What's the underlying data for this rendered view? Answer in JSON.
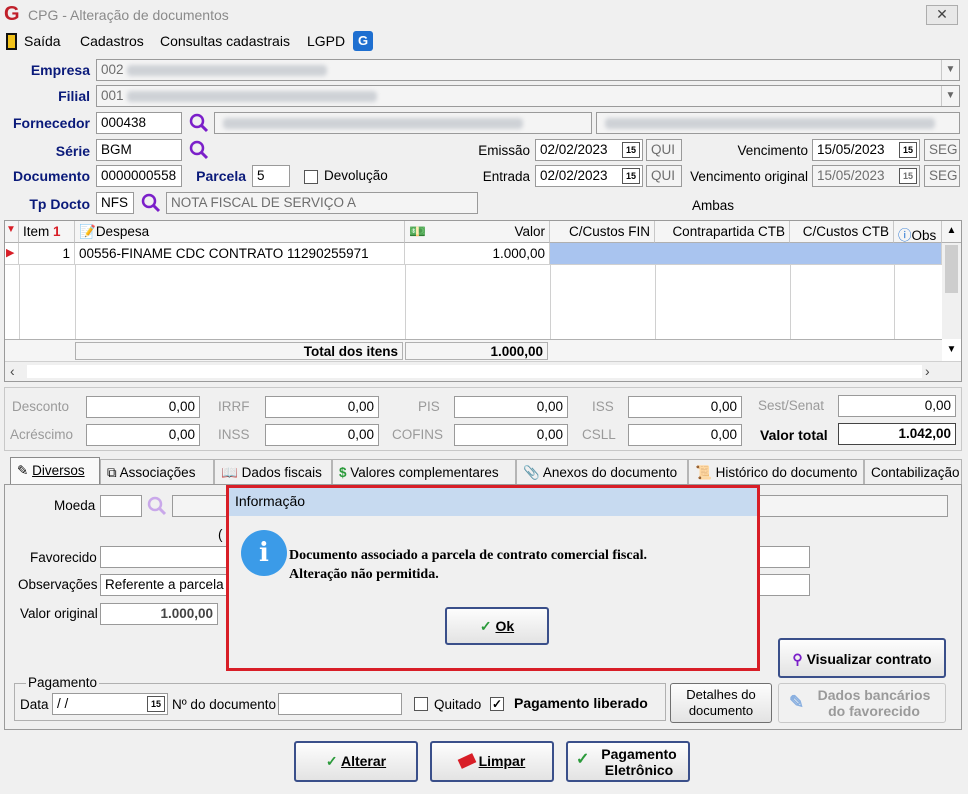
{
  "window": {
    "title": "CPG - Alteração de documentos",
    "close_label": "✕",
    "logo": "G"
  },
  "menu": {
    "items": [
      "Saída",
      "Cadastros",
      "Consultas cadastrais",
      "LGPD"
    ]
  },
  "header": {
    "empresa_label": "Empresa",
    "empresa_code": "002",
    "filial_label": "Filial",
    "filial_code": "001",
    "fornecedor_label": "Fornecedor",
    "fornecedor_code": "000438",
    "serie_label": "Série",
    "serie_value": "BGM",
    "documento_label": "Documento",
    "documento_value": "0000000558",
    "parcela_label": "Parcela",
    "parcela_value": "5",
    "devolucao_label": "Devolução",
    "tpdocto_label": "Tp Docto",
    "tpdocto_value": "NFS",
    "tpdocto_desc": "NOTA FISCAL DE SERVIÇO A",
    "emissao_label": "Emissão",
    "emissao_value": "02/02/2023",
    "emissao_day": "QUI",
    "entrada_label": "Entrada",
    "entrada_value": "02/02/2023",
    "entrada_day": "QUI",
    "vencimento_label": "Vencimento",
    "vencimento_value": "15/05/2023",
    "vencimento_day": "SEG",
    "venc_original_label": "Vencimento original",
    "venc_original_value": "15/05/2023",
    "venc_original_day": "SEG",
    "ambas_label": "Ambas"
  },
  "grid": {
    "columns": [
      "Item",
      "Despesa",
      "Valor",
      "C/Custos FIN",
      "Contrapartida CTB",
      "C/Custos CTB",
      "Obs"
    ],
    "rows": [
      {
        "item": "1",
        "despesa": "00556-FINAME CDC CONTRATO 11290255971",
        "valor": "1.000,00"
      }
    ],
    "total_label": "Total dos itens",
    "total_value": "1.000,00"
  },
  "totals": {
    "desconto_label": "Desconto",
    "desconto": "0,00",
    "acrescimo_label": "Acréscimo",
    "acrescimo": "0,00",
    "irrf_label": "IRRF",
    "irrf": "0,00",
    "inss_label": "INSS",
    "inss": "0,00",
    "pis_label": "PIS",
    "pis": "0,00",
    "cofins_label": "COFINS",
    "cofins": "0,00",
    "iss_label": "ISS",
    "iss": "0,00",
    "csll_label": "CSLL",
    "csll": "0,00",
    "sest_label": "Sest/Senat",
    "sest": "0,00",
    "valor_total_label": "Valor total",
    "valor_total": "1.042,00"
  },
  "tabs": [
    "Diversos",
    "Associações",
    "Dados fiscais",
    "Valores complementares",
    "Anexos do documento",
    "Histórico do documento",
    "Contabilização"
  ],
  "diversos": {
    "moeda_label": "Moeda",
    "favorecido_label": "Favorecido",
    "observacoes_label": "Observações",
    "observacoes_value": "Referente a parcela n",
    "valor_original_label": "Valor original",
    "valor_original_value": "1.000,00",
    "pagamento_group": "Pagamento",
    "data_label": "Data",
    "data_value": " /  /",
    "ndoc_label": "Nº do documento",
    "quitado_label": "Quitado",
    "pagamento_liberado_label": "Pagamento liberado",
    "detalhes_label_1": "Detalhes do",
    "detalhes_label_2": "documento",
    "visualizar_label": "Visualizar contrato",
    "dados_bancarios_1": "Dados bancários",
    "dados_bancarios_2": "do favorecido",
    "paren": "("
  },
  "dialog": {
    "title": "Informação",
    "line1": "Documento associado a parcela de contrato comercial fiscal.",
    "line2": "Alteração não permitida.",
    "ok_label": "Ok"
  },
  "footer": {
    "alterar": "Alterar",
    "limpar": "Limpar",
    "pag1": "Pagamento",
    "pag2": "Eletrônico"
  },
  "colors": {
    "accent": "#0a1a7a",
    "dialog_border": "#d81e27",
    "selected_cell": "#a9c4ef",
    "info_icon": "#3b9be8"
  }
}
